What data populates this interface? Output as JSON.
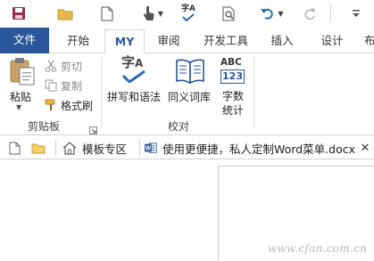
{
  "tabs": [
    "文件",
    "开始",
    "MY",
    "审阅",
    "开发工具",
    "插入",
    "设计",
    "布"
  ],
  "clipboard": {
    "paste": "粘贴",
    "cut": "剪切",
    "copy": "复制",
    "format_painter": "格式刷",
    "group_label": "剪贴板"
  },
  "proofing": {
    "spelling_1": "拼写和语法",
    "thesaurus": "同义词库",
    "word_count_line1": "字数",
    "word_count_line2": "统计",
    "group_label": "校对",
    "icon_abc": "ABC",
    "icon_123": "123",
    "icon_zi": "字",
    "icon_a": "A",
    "qat_zi": "字",
    "qat_a": "A"
  },
  "doc_tabs": {
    "templates": "模板专区",
    "document": "使用更便捷，私人定制Word菜单.docx",
    "close": "✕"
  },
  "watermark": "www.cfan.com.cn",
  "colors": {
    "accent": "#2b579a",
    "word_blue": "#2b5797"
  }
}
